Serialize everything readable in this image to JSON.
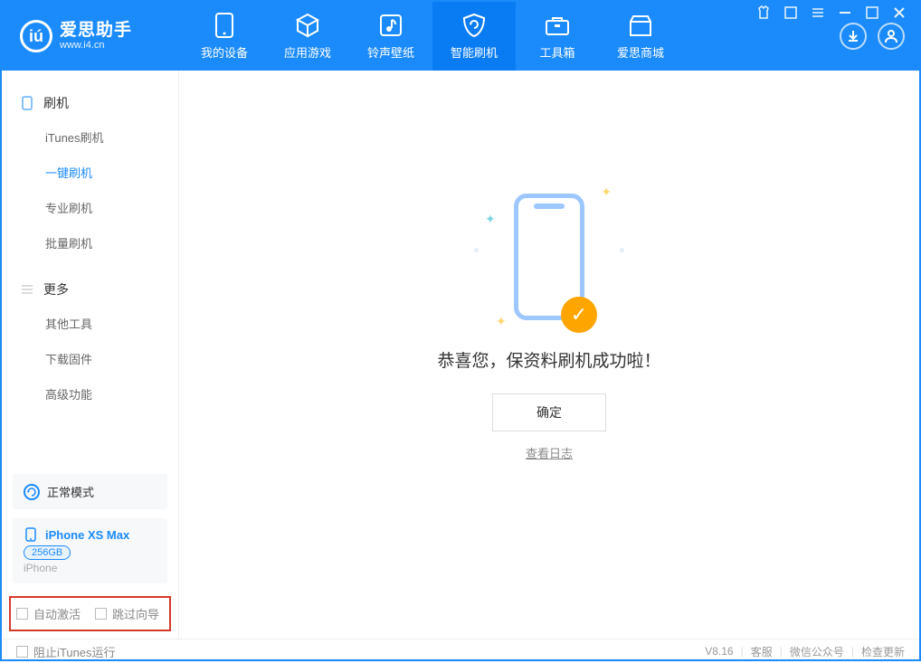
{
  "app": {
    "name": "爱思助手",
    "url": "www.i4.cn"
  },
  "tabs": [
    {
      "label": "我的设备"
    },
    {
      "label": "应用游戏"
    },
    {
      "label": "铃声壁纸"
    },
    {
      "label": "智能刷机"
    },
    {
      "label": "工具箱"
    },
    {
      "label": "爱思商城"
    }
  ],
  "sidebar": {
    "section1_title": "刷机",
    "section1_items": [
      {
        "label": "iTunes刷机"
      },
      {
        "label": "一键刷机"
      },
      {
        "label": "专业刷机"
      },
      {
        "label": "批量刷机"
      }
    ],
    "section2_title": "更多",
    "section2_items": [
      {
        "label": "其他工具"
      },
      {
        "label": "下载固件"
      },
      {
        "label": "高级功能"
      }
    ]
  },
  "device": {
    "mode": "正常模式",
    "name": "iPhone XS Max",
    "capacity": "256GB",
    "type": "iPhone"
  },
  "options": {
    "auto_activate": "自动激活",
    "skip_guide": "跳过向导"
  },
  "result": {
    "message": "恭喜您，保资料刷机成功啦！",
    "ok": "确定",
    "view_log": "查看日志"
  },
  "statusbar": {
    "block_itunes": "阻止iTunes运行",
    "version": "V8.16",
    "support": "客服",
    "wechat": "微信公众号",
    "check_update": "检查更新"
  },
  "colors": {
    "primary": "#1b8bfb"
  }
}
